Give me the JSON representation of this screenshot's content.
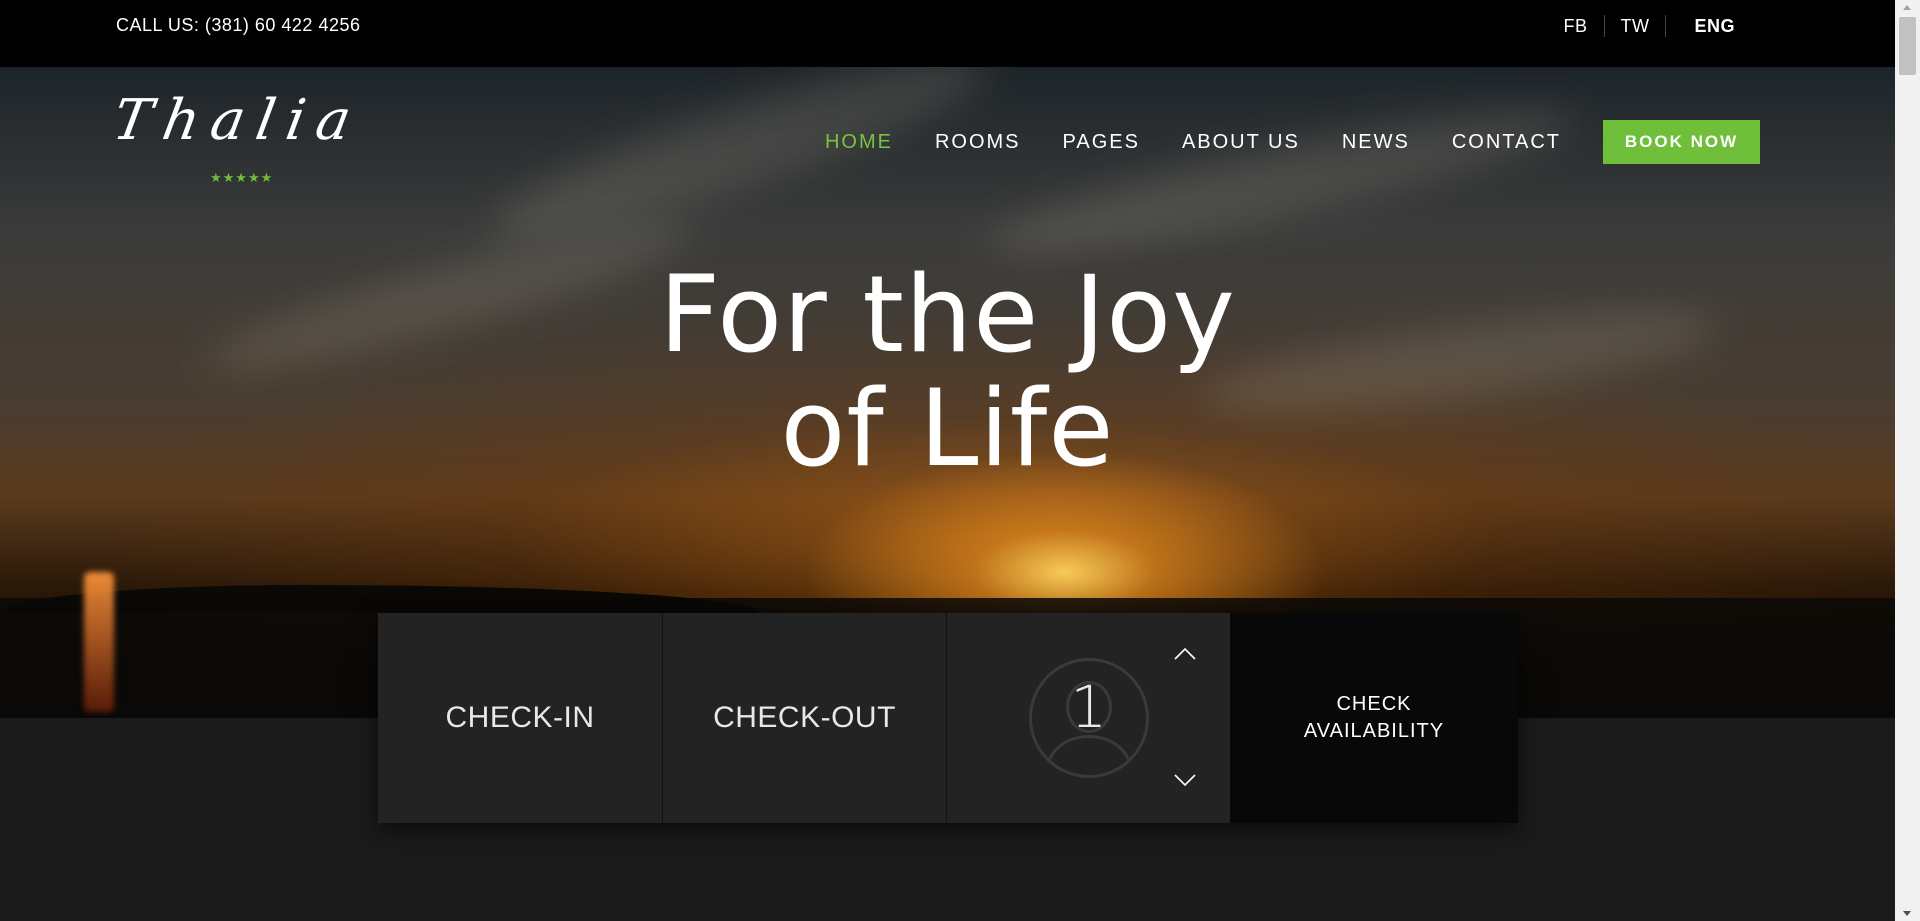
{
  "topbar": {
    "phone": "CALL US: (381) 60 422 4256",
    "social": [
      "FB",
      "TW"
    ],
    "language": "ENG"
  },
  "logo": {
    "text": "Thalia",
    "stars": "★★★★★"
  },
  "nav": {
    "items": [
      "HOME",
      "ROOMS",
      "PAGES",
      "ABOUT US",
      "NEWS",
      "CONTACT"
    ],
    "active": "HOME",
    "book_label": "BOOK NOW"
  },
  "hero": {
    "headline_line1": "For the Joy",
    "headline_line2": "of Life"
  },
  "booking": {
    "checkin_label": "CHECK-IN",
    "checkout_label": "CHECK-OUT",
    "guests": "1",
    "check_line1": "CHECK",
    "check_line2": "AVAILABILITY"
  },
  "colors": {
    "accent": "#6fbf3b",
    "topbar": "#000000",
    "panel": "#232323",
    "page_bg": "#1b1b1b"
  }
}
